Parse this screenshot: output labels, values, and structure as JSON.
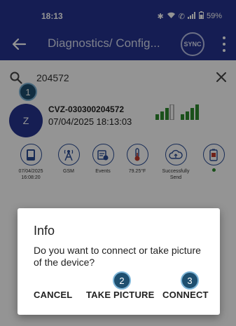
{
  "status_bar": {
    "time": "18:13",
    "battery": "59%"
  },
  "app_bar": {
    "title": "Diagnostics/ Config...",
    "sync_label": "SYNC"
  },
  "search": {
    "value": "204572"
  },
  "device": {
    "avatar_letter": "Z",
    "name": "CVZ-030300204572",
    "datetime": "07/04/2025  18:13:03"
  },
  "info_items": [
    {
      "icon": "device-icon",
      "label": "07/04/2025 16:08:20"
    },
    {
      "icon": "gsm-tower-icon",
      "label": "GSM"
    },
    {
      "icon": "events-icon",
      "label": "Events"
    },
    {
      "icon": "thermometer-icon",
      "label": "79.25°F"
    },
    {
      "icon": "cloud-upload-icon",
      "label": "Successfully Send"
    },
    {
      "icon": "battery-device-icon",
      "label": ""
    }
  ],
  "step_badges": {
    "one": "1",
    "two": "2",
    "three": "3"
  },
  "dialog": {
    "title": "Info",
    "message": "Do you want to connect or take picture of the device?",
    "cancel": "CANCEL",
    "take_picture": "TAKE PICTURE",
    "connect": "CONNECT"
  },
  "colors": {
    "primary": "#25338f",
    "signal_green": "#2d8a2d",
    "badge": "#1e4f6f"
  }
}
